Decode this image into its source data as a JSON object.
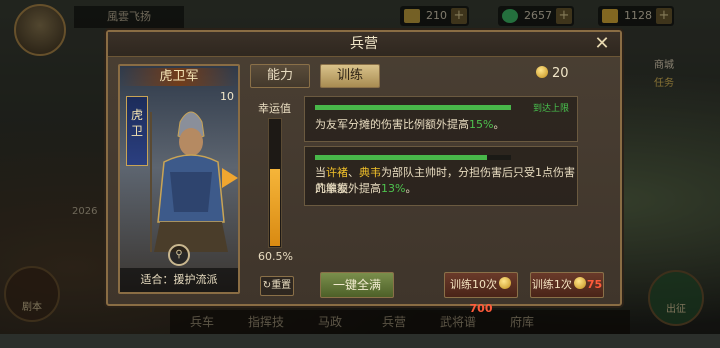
{
  "topbar": {
    "player_name": "風雲飞扬",
    "resources": [
      {
        "name": "food",
        "icon": "grain-icon",
        "value": "210",
        "color": "#c9a640"
      },
      {
        "name": "jade",
        "icon": "jade-icon",
        "value": "2657",
        "color": "#3fbf6a"
      },
      {
        "name": "gold",
        "icon": "gold-icon",
        "value": "1128",
        "color": "#e0b23a"
      }
    ]
  },
  "side": {
    "left_year": "2026",
    "left_btn1": "剧本",
    "right_btn": "出征",
    "right_top": "商城",
    "right_task": "任务"
  },
  "bottom_nav": [
    "兵车",
    "指挥技",
    "马政",
    "兵营",
    "武将谱",
    "府库"
  ],
  "dialog": {
    "title": "兵营",
    "close_label": "✕",
    "tabs": [
      {
        "label": "能力",
        "active": false
      },
      {
        "label": "训练",
        "active": true
      }
    ],
    "cost": "20",
    "card": {
      "unit_name": "虎卫军",
      "level": "10",
      "banner_text": "虎卫",
      "suitable_label": "适合：援护流派"
    },
    "luck": {
      "label": "幸运值",
      "percent_text": "60.5%",
      "value": 0.605
    },
    "effects": [
      {
        "progress": 1.0,
        "tag": "到达上限",
        "text_pre": "为友军分摊的伤害比例额外提高",
        "text_val": "15%",
        "text_post": "。"
      },
      {
        "progress": 0.88,
        "line1_pre": "当",
        "line1_name1": "许褚",
        "line1_sep": "、",
        "line1_name2": "典韦",
        "line1_post": "为部队主帅时，分担伤害后只受1点伤害的触发",
        "line2_pre": "几率额外提高",
        "line2_val": "13%",
        "line2_post": "。"
      }
    ],
    "buttons": {
      "reset": "重置",
      "fill_all": "一键全满",
      "train10_label": "训练10次",
      "train10_price": "700",
      "train1_label": "训练1次",
      "train1_price": "75"
    }
  },
  "colors": {
    "accent_gold": "#c9a455",
    "progress_green": "#48b84a",
    "gauge_orange": "#f0a630"
  }
}
